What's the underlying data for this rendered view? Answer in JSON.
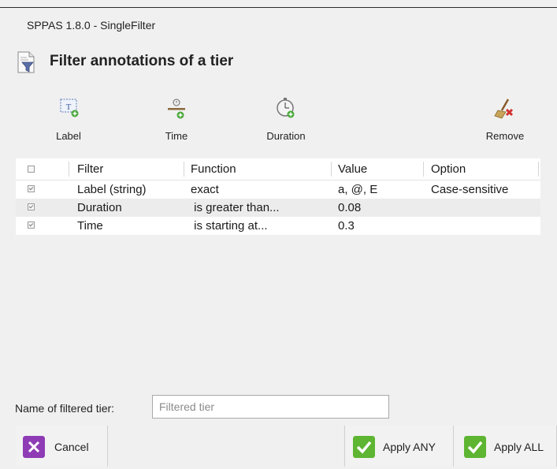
{
  "window": {
    "title": "SPPAS 1.8.0  - SingleFilter"
  },
  "header": {
    "title": "Filter annotations of a tier",
    "icon": "filter-document-icon"
  },
  "toolbar": {
    "label": "Label",
    "time": "Time",
    "duration": "Duration",
    "remove": "Remove"
  },
  "table": {
    "columns": [
      "Filter",
      "Function",
      "Value",
      "Option"
    ],
    "rows": [
      {
        "checked": true,
        "filter": "Label (string)",
        "function": "exact",
        "value": "a, @, E",
        "option": "Case-sensitive"
      },
      {
        "checked": true,
        "filter": "Duration",
        "function": " is greater than...",
        "value": "0.08",
        "option": ""
      },
      {
        "checked": true,
        "filter": "Time",
        "function": " is starting at...",
        "value": "0.3",
        "option": ""
      }
    ]
  },
  "name_field": {
    "label": "Name of filtered tier:",
    "placeholder": "Filtered tier",
    "value": ""
  },
  "buttons": {
    "cancel": "Cancel",
    "apply_any": "Apply ANY",
    "apply_all": "Apply ALL"
  },
  "colors": {
    "cancel_icon": "#8e3bb5",
    "apply_icon": "#5db532"
  }
}
